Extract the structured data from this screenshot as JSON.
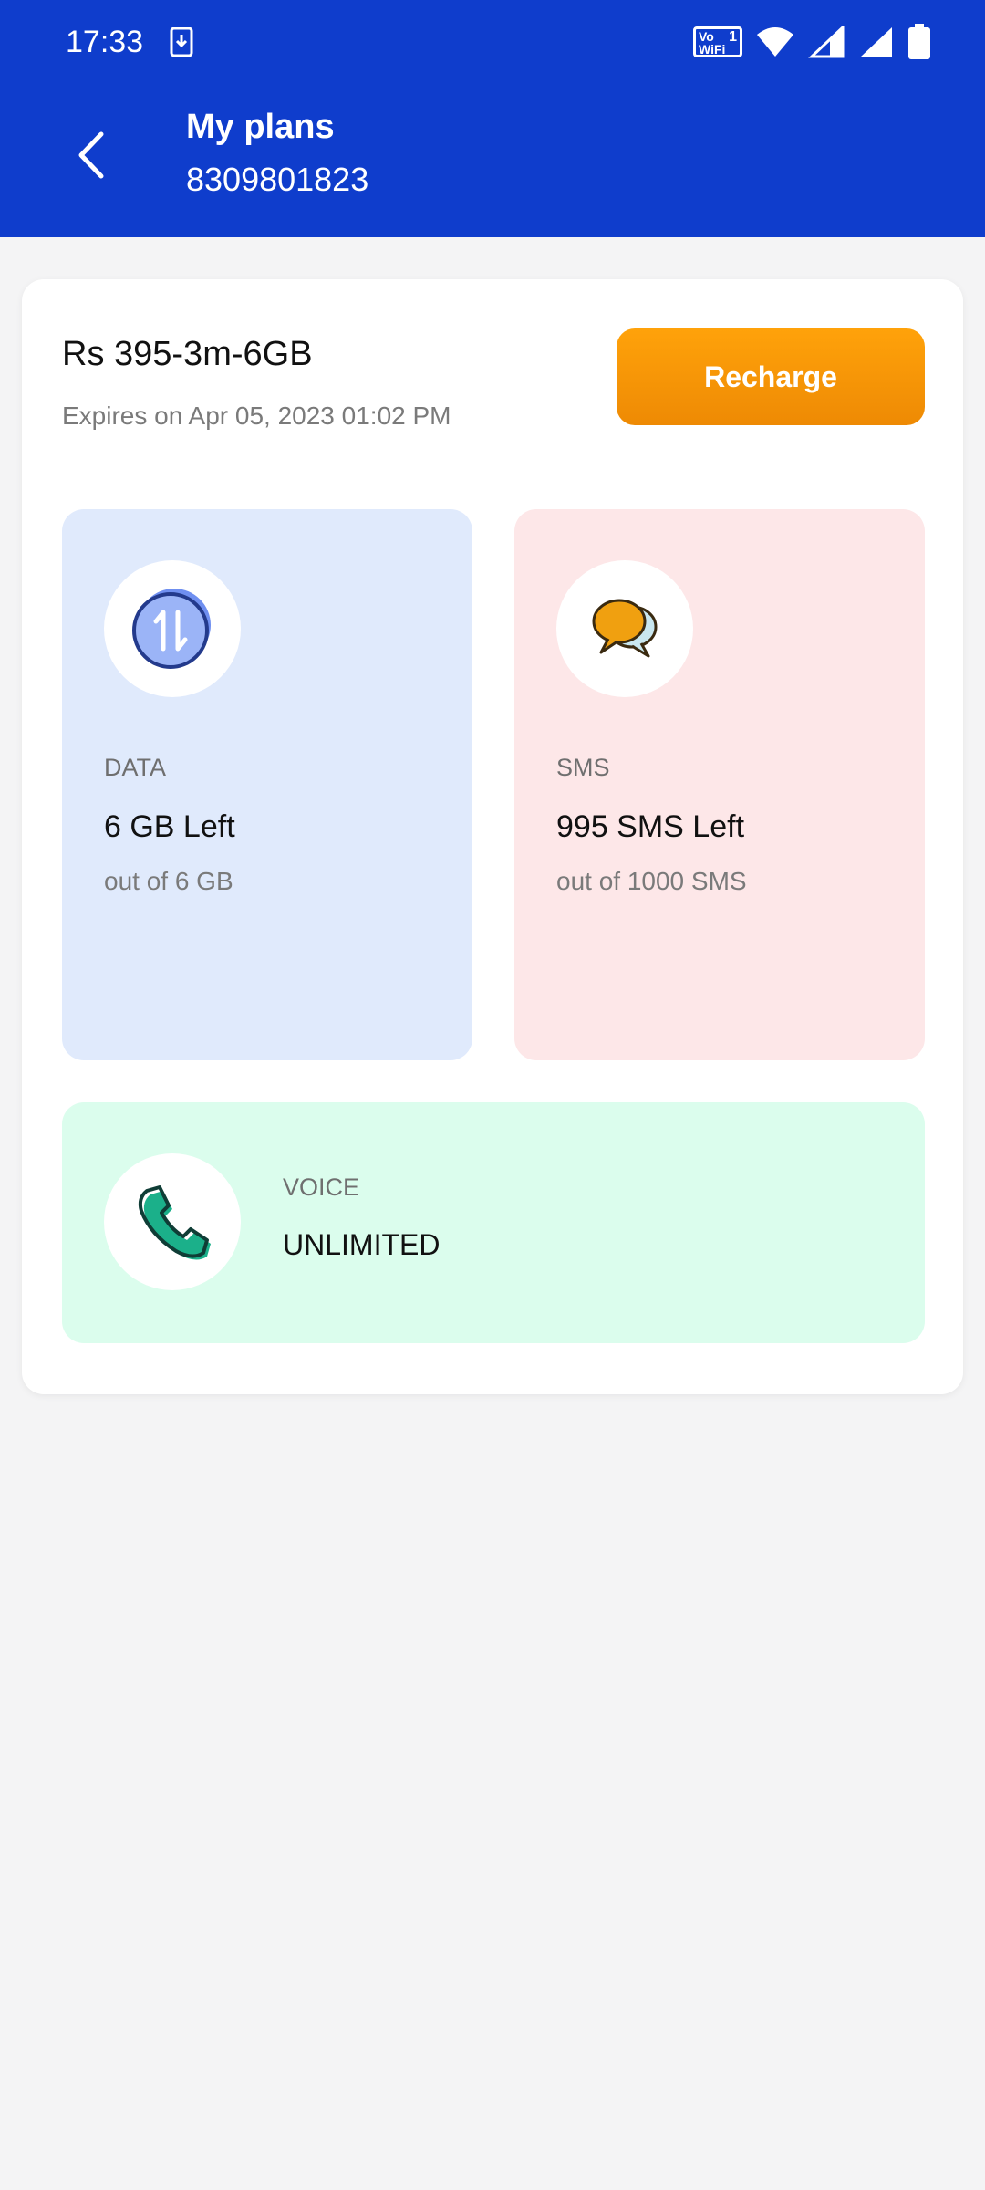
{
  "status_bar": {
    "time": "17:33",
    "vowifi_top": "Vo",
    "vowifi_bottom": "WiFi",
    "vowifi_slot": "1",
    "icons": [
      "download-notification-icon",
      "vowifi-icon",
      "wifi-icon",
      "signal-icon",
      "signal-icon",
      "battery-icon"
    ]
  },
  "header": {
    "title": "My plans",
    "phone_number": "8309801823",
    "background_color": "#0f3dcc"
  },
  "plan": {
    "name": "Rs 395-3m-6GB",
    "expiry": "Expires on Apr 05, 2023 01:02 PM",
    "recharge_label": "Recharge",
    "accent_color": "#f59a06"
  },
  "tiles": {
    "data": {
      "label": "DATA",
      "value": "6 GB Left",
      "sub": "out of 6 GB",
      "icon": "data-transfer-icon"
    },
    "sms": {
      "label": "SMS",
      "value": "995 SMS Left",
      "sub": "out of 1000 SMS",
      "icon": "chat-bubbles-icon"
    },
    "voice": {
      "label": "VOICE",
      "value": "UNLIMITED",
      "icon": "phone-icon"
    }
  }
}
